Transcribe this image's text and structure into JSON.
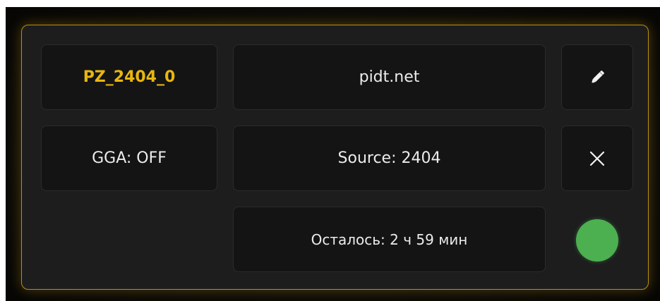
{
  "session": {
    "name": "PZ_2404_0",
    "host": "pidt.net",
    "gga": "GGA: OFF",
    "source": "Source: 2404",
    "remaining": "Осталось: 2 ч 59 мин"
  },
  "actions": {
    "edit_icon": "pencil-icon",
    "close_icon": "close-icon"
  },
  "status": {
    "state": "connected",
    "color": "#4caf50"
  },
  "colors": {
    "accent": "#e8b70f",
    "border": "#b8900f",
    "panel": "#1d1d1e",
    "tile": "#141415"
  }
}
